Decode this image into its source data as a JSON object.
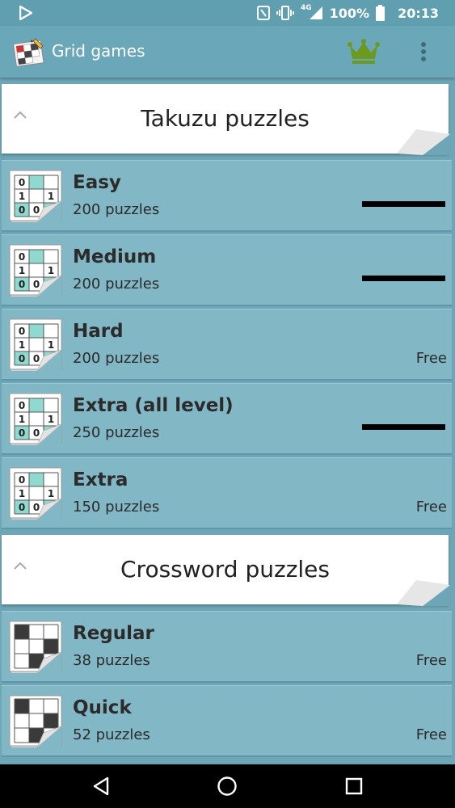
{
  "status_bar": {
    "network": "4G",
    "battery": "100%",
    "time": "20:13"
  },
  "app_bar": {
    "title": "Grid games",
    "premium_icon": "crown-icon",
    "menu_icon": "more-vert-icon"
  },
  "sections": [
    {
      "title": "Takuzu puzzles",
      "items": [
        {
          "name": "Easy",
          "count": "200 puzzles",
          "status": "",
          "progress_bar": true
        },
        {
          "name": "Medium",
          "count": "200 puzzles",
          "status": "",
          "progress_bar": true
        },
        {
          "name": "Hard",
          "count": "200 puzzles",
          "status": "Free",
          "progress_bar": false
        },
        {
          "name": "Extra (all level)",
          "count": "250 puzzles",
          "status": "",
          "progress_bar": true
        },
        {
          "name": "Extra",
          "count": "150 puzzles",
          "status": "Free",
          "progress_bar": false
        }
      ]
    },
    {
      "title": "Crossword puzzles",
      "items": [
        {
          "name": "Regular",
          "count": "38 puzzles",
          "status": "Free",
          "progress_bar": false
        },
        {
          "name": "Quick",
          "count": "52 puzzles",
          "status": "Free",
          "progress_bar": false
        }
      ]
    }
  ],
  "takuzu_thumb_digits": [
    "0",
    "1",
    "1",
    "0",
    "0"
  ],
  "colors": {
    "accent": "#6aa7b8",
    "row_bg": "#82b7c6",
    "takuzu_cell": "#8fd9d0",
    "crown": "#6b9a1f"
  }
}
